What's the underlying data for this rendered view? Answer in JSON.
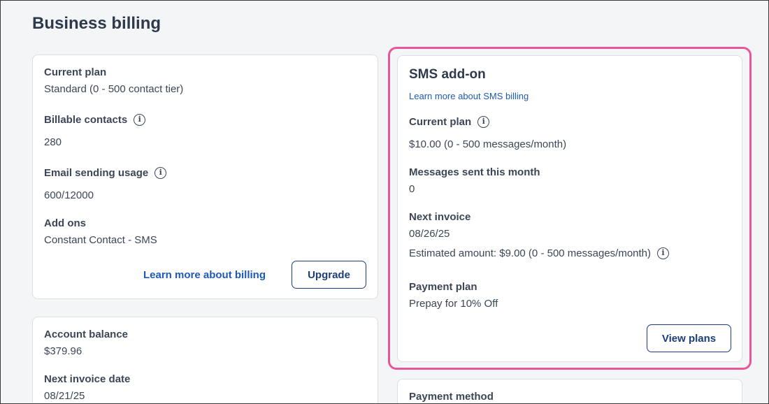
{
  "page_title": "Business billing",
  "plan_card": {
    "current_plan_label": "Current plan",
    "current_plan_value": "Standard (0 - 500 contact tier)",
    "billable_contacts_label": "Billable contacts",
    "billable_contacts_value": "280",
    "email_usage_label": "Email sending usage",
    "email_usage_value": "600/12000",
    "add_ons_label": "Add ons",
    "add_ons_value": "Constant Contact - SMS",
    "learn_more_link": "Learn more about billing",
    "upgrade_button": "Upgrade"
  },
  "balance_card": {
    "account_balance_label": "Account balance",
    "account_balance_value": "$379.96",
    "next_invoice_date_label": "Next invoice date",
    "next_invoice_date_value": "08/21/25"
  },
  "sms_card": {
    "title": "SMS add-on",
    "learn_more_link": "Learn more about SMS billing",
    "current_plan_label": "Current plan",
    "current_plan_value": "$10.00 (0 - 500 messages/month)",
    "messages_sent_label": "Messages sent this month",
    "messages_sent_value": "0",
    "next_invoice_label": "Next invoice",
    "next_invoice_date": "08/26/25",
    "estimated_amount": "Estimated amount: $9.00 (0 - 500 messages/month)",
    "payment_plan_label": "Payment plan",
    "payment_plan_value": "Prepay for 10% Off",
    "view_plans_button": "View plans"
  },
  "payment_card": {
    "payment_method_label": "Payment method"
  },
  "icons": {
    "info": "info-icon"
  },
  "colors": {
    "highlight": "#e8569a",
    "link": "#1d5ab8",
    "button_border": "#1c3d7a"
  }
}
